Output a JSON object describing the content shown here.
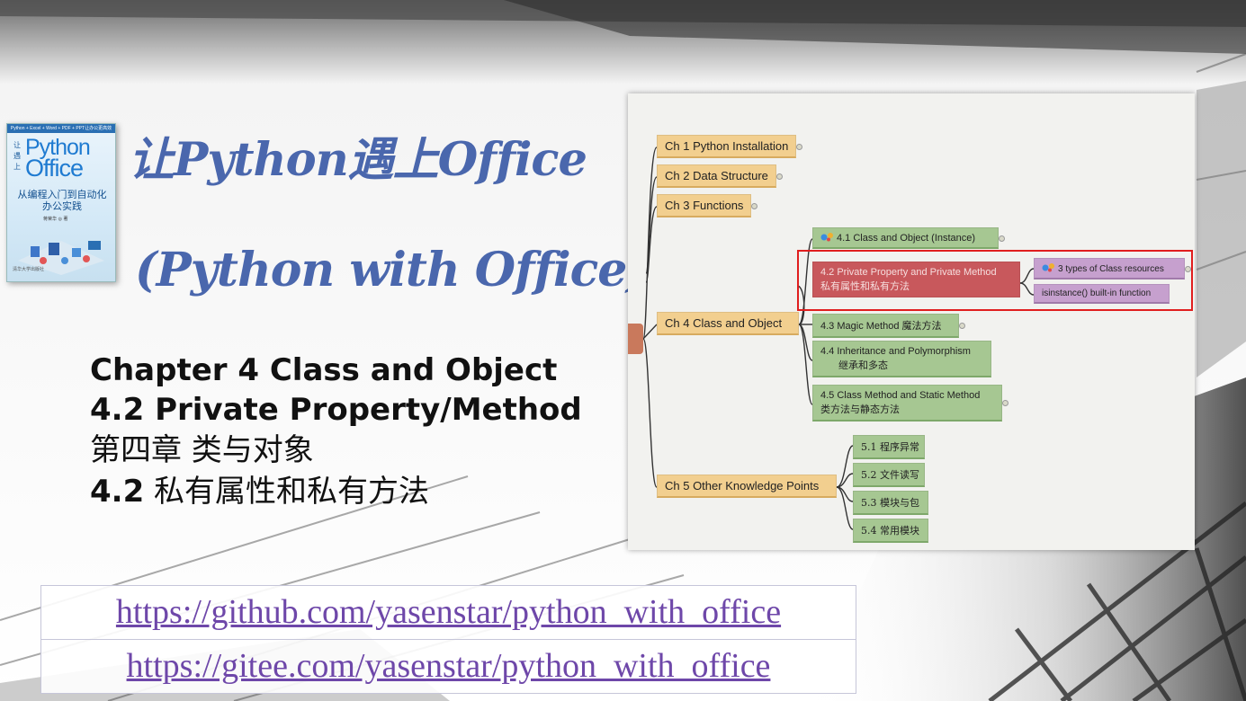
{
  "slide": {
    "title_cn": "让Python遇上Office",
    "title_en": "(Python with Office)",
    "chapter_en_1": "Chapter 4 Class and Object",
    "chapter_en_2": "4.2 Private Property/Method",
    "chapter_cn_1": "第四章 类与对象",
    "chapter_cn_2_num": "4.2",
    "chapter_cn_2_text": " 私有属性和私有方法"
  },
  "book": {
    "strip": "Python + Excel + Word + PDF + PPT让办公更高效",
    "side_text": "让遇上",
    "title_python": "Python",
    "title_office": "Office",
    "subtitle": "从编程入门到自动化办公实践",
    "author": "蒋荣华 ◎ 著",
    "publisher": "清华大学出版社"
  },
  "links": {
    "github": "https://github.com/yasenstar/python_with_office",
    "gitee": "https://gitee.com/yasenstar/python_with_office"
  },
  "mindmap": {
    "chapters": [
      "Ch 1 Python Installation",
      "Ch 2 Data Structure",
      "Ch 3 Functions",
      "Ch 4 Class and Object",
      "Ch 5 Other Knowledge Points"
    ],
    "ch4_sections": {
      "s41": "4.1 Class and Object (Instance)",
      "s42_en": "4.2 Private Property and Private Method",
      "s42_cn": "私有属性和私有方法",
      "s43_en": "4.3 Magic Method ",
      "s43_cn": "魔法方法",
      "s44_en": "4.4 Inheritance and Polymorphism",
      "s44_cn": "继承和多态",
      "s45_en": "4.5 Class Method and Static Method",
      "s45_cn": "类方法与静态方法"
    },
    "ch42_children": {
      "c1": "3 types of Class resources",
      "c2": "isinstance() built-in function"
    },
    "ch5_sections": [
      "5.1 程序异常",
      "5.2 文件读写",
      "5.3 模块与包",
      "5.4 常用模块"
    ]
  },
  "colors": {
    "title": "#4a67ad",
    "link": "#6e47a9",
    "chapter_node": "#f2cf8f",
    "section_node": "#a6c792",
    "selected_node": "#c8585c",
    "child_node": "#c6a0ce",
    "highlight_box": "#e01e1e"
  }
}
